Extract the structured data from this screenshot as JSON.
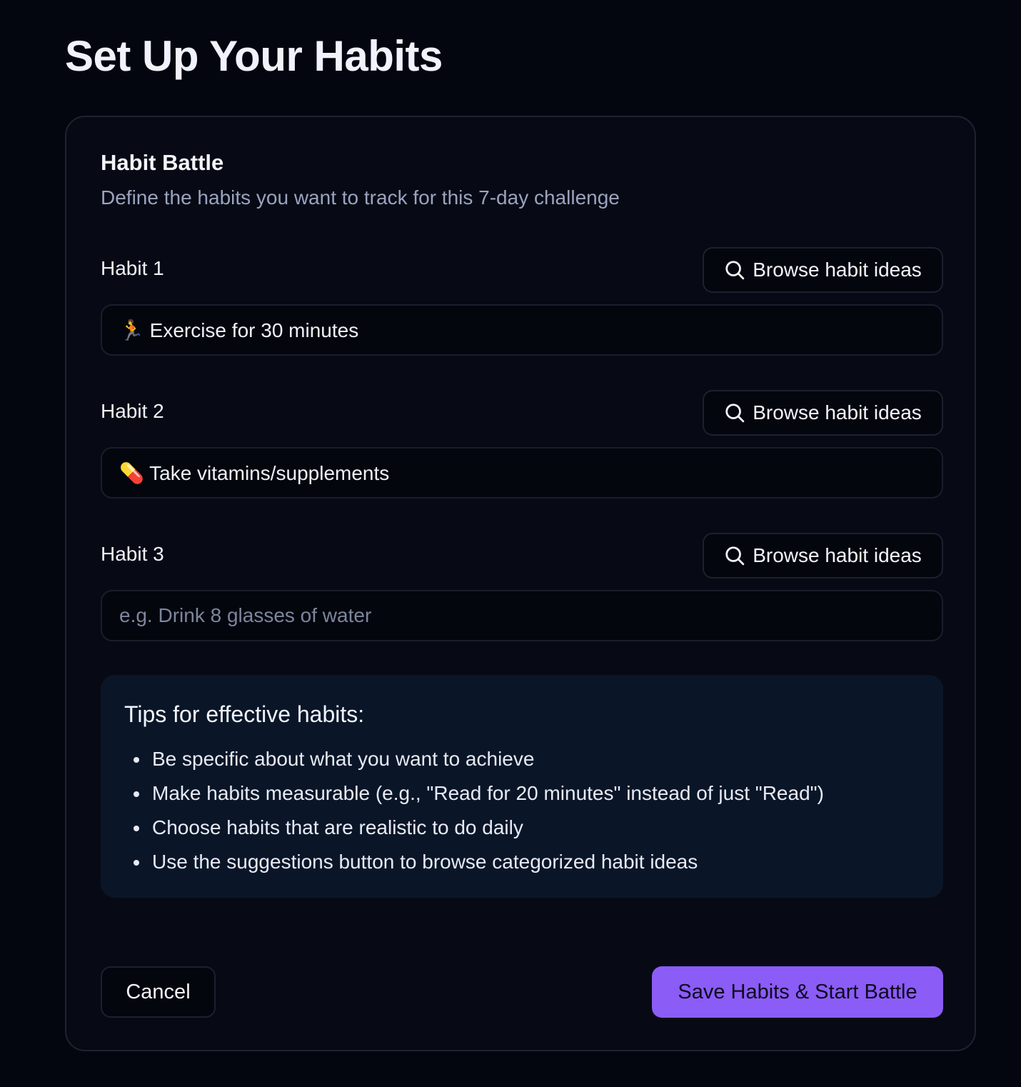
{
  "page": {
    "title": "Set Up Your Habits"
  },
  "card": {
    "title": "Habit Battle",
    "subtitle": "Define the habits you want to track for this 7-day challenge"
  },
  "habits": [
    {
      "label": "Habit 1",
      "browse_label": "Browse habit ideas",
      "value": "🏃 Exercise for 30 minutes",
      "placeholder": "e.g. Drink 8 glasses of water"
    },
    {
      "label": "Habit 2",
      "browse_label": "Browse habit ideas",
      "value": "💊 Take vitamins/supplements",
      "placeholder": "e.g. Drink 8 glasses of water"
    },
    {
      "label": "Habit 3",
      "browse_label": "Browse habit ideas",
      "value": "",
      "placeholder": "e.g. Drink 8 glasses of water"
    }
  ],
  "tips": {
    "title": "Tips for effective habits:",
    "items": [
      "Be specific about what you want to achieve",
      "Make habits measurable (e.g., \"Read for 20 minutes\" instead of just \"Read\")",
      "Choose habits that are realistic to do daily",
      "Use the suggestions button to browse categorized habit ideas"
    ]
  },
  "actions": {
    "cancel_label": "Cancel",
    "save_label": "Save Habits & Start Battle"
  },
  "icons": {
    "browse": "search-icon"
  },
  "colors": {
    "background": "#04060f",
    "card": "#070a14",
    "tips_panel": "#0a1628",
    "accent": "#8b5cf6",
    "muted_text": "#9aa3c0"
  }
}
